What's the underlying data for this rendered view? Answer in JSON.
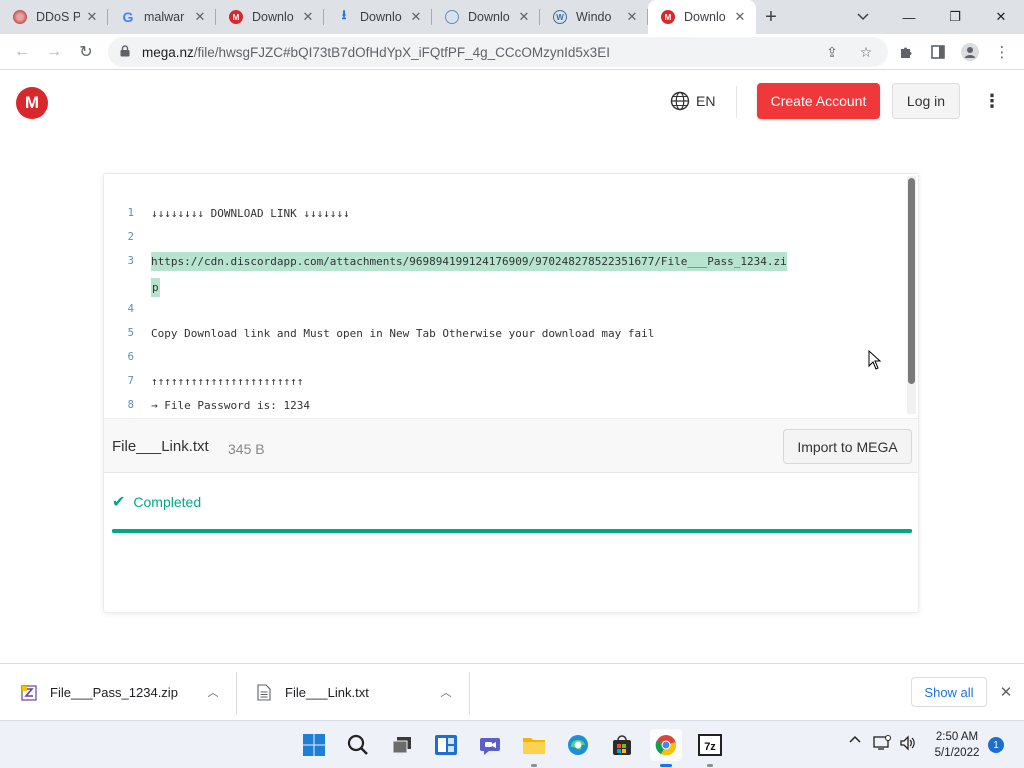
{
  "browser": {
    "tabs": [
      {
        "title": "DDoS P",
        "favicon": "virus-favicon"
      },
      {
        "title": "malwar",
        "favicon": "google-favicon"
      },
      {
        "title": "Downlo",
        "favicon": "mega-favicon"
      },
      {
        "title": "Downlo",
        "favicon": "download-favicon"
      },
      {
        "title": "Downlo",
        "favicon": "globe-favicon"
      },
      {
        "title": "Windo",
        "favicon": "wordpress-favicon"
      },
      {
        "title": "Downlo",
        "favicon": "mega-favicon",
        "active": true
      }
    ],
    "url_host": "mega.nz",
    "url_path": "/file/hwsgFJZC#bQI73tB7dOfHdYpX_iFQtfPF_4g_CCcOMzynId5x3EI"
  },
  "mega": {
    "logo_letter": "M",
    "language": "EN",
    "create_account_label": "Create Account",
    "login_label": "Log in",
    "code_lines": [
      {
        "num": "1",
        "text": "↓↓↓↓↓↓↓↓ DOWNLOAD LINK ↓↓↓↓↓↓↓"
      },
      {
        "num": "2",
        "text": ""
      },
      {
        "num": "3",
        "text": "https://cdn.discordapp.com/attachments/969894199124176909/970248278522351677/File___Pass_1234.zi"
      },
      {
        "num": "",
        "text": "p"
      },
      {
        "num": "4",
        "text": ""
      },
      {
        "num": "5",
        "text": "Copy Download link and Must open in New Tab Otherwise your download may fail"
      },
      {
        "num": "6",
        "text": ""
      },
      {
        "num": "7",
        "text": "↑↑↑↑↑↑↑↑↑↑↑↑↑↑↑↑↑↑↑↑↑↑↑"
      },
      {
        "num": "8",
        "text": "→ File Password is: 1234"
      }
    ],
    "file_name": "File___Link.txt",
    "file_size": "345 B",
    "import_label": "Import to MEGA",
    "status_text": "Completed",
    "progress_fraction": 1.0,
    "accent_color": "#00a886",
    "brand_color": "#d9272e"
  },
  "downloads": {
    "items": [
      {
        "name": "File___Pass_1234.zip",
        "icon": "zip-file-icon"
      },
      {
        "name": "File___Link.txt",
        "icon": "text-file-icon"
      }
    ],
    "show_all_label": "Show all"
  },
  "taskbar": {
    "apps": [
      "start",
      "search",
      "task-view",
      "widgets",
      "chat",
      "file-explorer",
      "edge",
      "store",
      "chrome",
      "7zip"
    ],
    "time": "2:50 AM",
    "date": "5/1/2022",
    "notification_count": "1"
  }
}
